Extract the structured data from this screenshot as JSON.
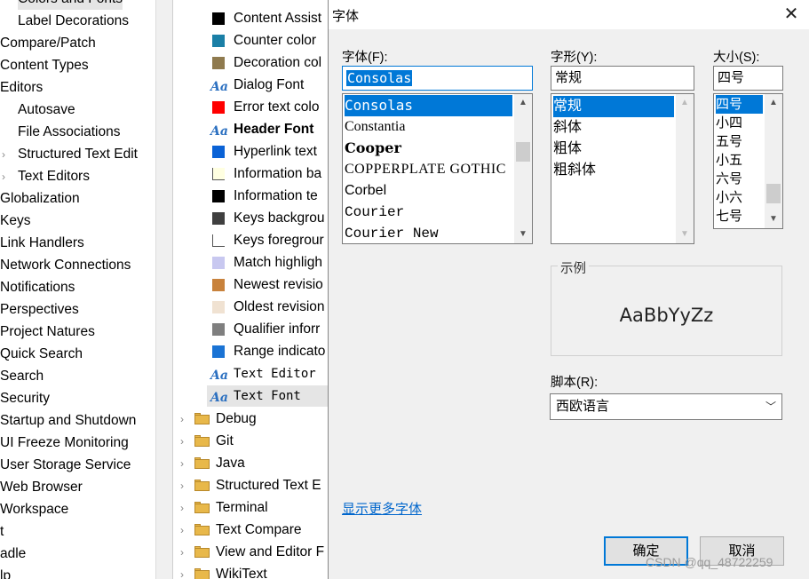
{
  "left_tree": {
    "items": [
      {
        "label": "Colors and Fonts",
        "indent": 1,
        "chevron": false
      },
      {
        "label": "Label Decorations",
        "indent": 1,
        "chevron": false
      },
      {
        "label": "Compare/Patch",
        "indent": 0,
        "chevron": false
      },
      {
        "label": "Content Types",
        "indent": 0,
        "chevron": false
      },
      {
        "label": "Editors",
        "indent": 0,
        "chevron": false
      },
      {
        "label": "Autosave",
        "indent": 1,
        "chevron": false
      },
      {
        "label": "File Associations",
        "indent": 1,
        "chevron": false
      },
      {
        "label": "Structured Text Edit",
        "indent": 1,
        "chevron": true
      },
      {
        "label": "Text Editors",
        "indent": 1,
        "chevron": true
      },
      {
        "label": "Globalization",
        "indent": 0,
        "chevron": false
      },
      {
        "label": "Keys",
        "indent": 0,
        "chevron": false
      },
      {
        "label": "Link Handlers",
        "indent": 0,
        "chevron": false
      },
      {
        "label": "Network Connections",
        "indent": 0,
        "chevron": false
      },
      {
        "label": "Notifications",
        "indent": 0,
        "chevron": false
      },
      {
        "label": "Perspectives",
        "indent": 0,
        "chevron": false
      },
      {
        "label": "Project Natures",
        "indent": 0,
        "chevron": false
      },
      {
        "label": "Quick Search",
        "indent": 0,
        "chevron": false
      },
      {
        "label": "Search",
        "indent": 0,
        "chevron": false
      },
      {
        "label": "Security",
        "indent": 0,
        "chevron": false
      },
      {
        "label": "Startup and Shutdown",
        "indent": 0,
        "chevron": false
      },
      {
        "label": "UI Freeze Monitoring",
        "indent": 0,
        "chevron": false
      },
      {
        "label": "User Storage Service",
        "indent": 0,
        "chevron": false
      },
      {
        "label": "Web Browser",
        "indent": 0,
        "chevron": false
      },
      {
        "label": "Workspace",
        "indent": 0,
        "chevron": false
      },
      {
        "label": "t",
        "indent": 0,
        "chevron": false
      },
      {
        "label": "adle",
        "indent": 0,
        "chevron": false
      },
      {
        "label": "lp",
        "indent": 0,
        "chevron": false
      }
    ]
  },
  "color_list": {
    "items": [
      {
        "label": "Content Assist",
        "kind": "swatch",
        "color": "#000000",
        "bold": false,
        "mono": false
      },
      {
        "label": "Counter color",
        "kind": "swatch",
        "color": "#1a7fa6",
        "bold": false,
        "mono": false
      },
      {
        "label": "Decoration col",
        "kind": "swatch",
        "color": "#8f7a4e",
        "bold": false,
        "mono": false
      },
      {
        "label": "Dialog Font",
        "kind": "font",
        "color": "",
        "bold": false,
        "mono": false
      },
      {
        "label": "Error text colo",
        "kind": "swatch",
        "color": "#ff0000",
        "bold": false,
        "mono": false
      },
      {
        "label": "Header Font",
        "kind": "font",
        "color": "",
        "bold": true,
        "mono": false
      },
      {
        "label": "Hyperlink text",
        "kind": "swatch",
        "color": "#0a62d6",
        "bold": false,
        "mono": false
      },
      {
        "label": "Information ba",
        "kind": "swatch",
        "color": "#ffffe1",
        "bold": false,
        "mono": false
      },
      {
        "label": "Information te",
        "kind": "swatch",
        "color": "#000000",
        "bold": false,
        "mono": false
      },
      {
        "label": "Keys backgrou",
        "kind": "swatch",
        "color": "#3f3f3f",
        "bold": false,
        "mono": false
      },
      {
        "label": "Keys foregrour",
        "kind": "swatch",
        "color": "#ffffff",
        "bold": false,
        "mono": false
      },
      {
        "label": "Match highligh",
        "kind": "swatch",
        "color": "#c8c8f0",
        "bold": false,
        "mono": false
      },
      {
        "label": "Newest revisio",
        "kind": "swatch",
        "color": "#c8823c",
        "bold": false,
        "mono": false
      },
      {
        "label": "Oldest revision",
        "kind": "swatch",
        "color": "#f0e2d2",
        "bold": false,
        "mono": false
      },
      {
        "label": "Qualifier inforr",
        "kind": "swatch",
        "color": "#7f7f7f",
        "bold": false,
        "mono": false
      },
      {
        "label": "Range indicato",
        "kind": "swatch",
        "color": "#1a73d4",
        "bold": false,
        "mono": false
      },
      {
        "label": "Text Editor",
        "kind": "font",
        "color": "",
        "bold": false,
        "mono": true
      },
      {
        "label": "Text Font",
        "kind": "font",
        "color": "",
        "bold": false,
        "mono": true,
        "selected": true
      }
    ],
    "folders": [
      "Debug",
      "Git",
      "Java",
      "Structured Text E",
      "Terminal",
      "Text Compare",
      "View and Editor F",
      "WikiText"
    ]
  },
  "font_dialog": {
    "title": "字体",
    "close_glyph": "✕",
    "font_label": "字体(F):",
    "font_value": "Consolas",
    "fonts": [
      "Consolas",
      "Constantia",
      "Cooper",
      "COPPERPLATE GOTHIC",
      "Corbel",
      "Courier",
      "Courier New"
    ],
    "selected_font": "Consolas",
    "style_label": "字形(Y):",
    "style_value": "常规",
    "styles": [
      "常规",
      "斜体",
      "粗体",
      "粗斜体"
    ],
    "size_label": "大小(S):",
    "size_value": "四号",
    "sizes": [
      "四号",
      "小四",
      "五号",
      "小五",
      "六号",
      "小六",
      "七号"
    ],
    "sample_label": "示例",
    "sample_text": "AaBbYyZz",
    "script_label": "脚本(R):",
    "script_value": "西欧语言",
    "more_fonts_link": "显示更多字体",
    "ok_label": "确定",
    "cancel_label": "取消"
  },
  "watermark": "CSDN @qq_48722259"
}
